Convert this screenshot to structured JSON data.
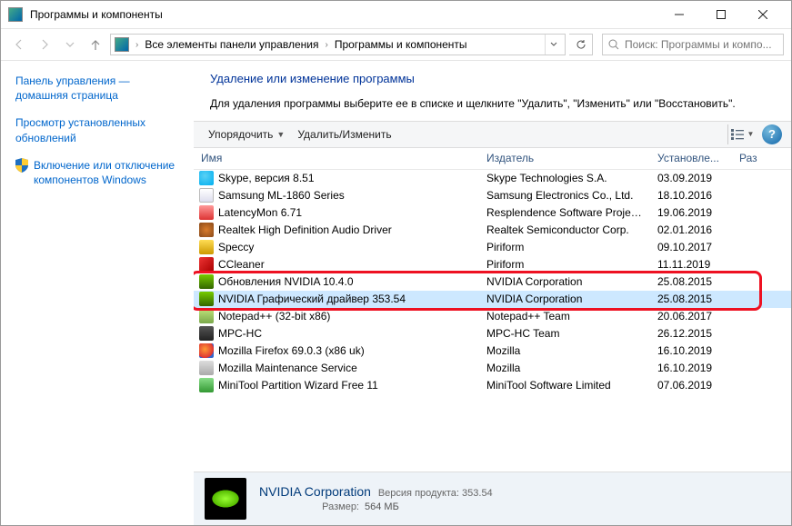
{
  "window": {
    "title": "Программы и компоненты"
  },
  "breadcrumb": {
    "item1": "Все элементы панели управления",
    "item2": "Программы и компоненты"
  },
  "search": {
    "placeholder": "Поиск: Программы и компо..."
  },
  "sidebar": {
    "items": [
      {
        "label": "Панель управления — домашняя страница"
      },
      {
        "label": "Просмотр установленных обновлений"
      },
      {
        "label": "Включение или отключение компонентов Windows"
      }
    ]
  },
  "heading": "Удаление или изменение программы",
  "subtext": "Для удаления программы выберите ее в списке и щелкните \"Удалить\", \"Изменить\" или \"Восстановить\".",
  "toolbar": {
    "organize": "Упорядочить",
    "action": "Удалить/Изменить"
  },
  "columns": {
    "name": "Имя",
    "publisher": "Издатель",
    "installed": "Установле...",
    "size": "Раз"
  },
  "programs": [
    {
      "icon": "ic-skype",
      "name": "Skype, версия 8.51",
      "publisher": "Skype Technologies S.A.",
      "date": "03.09.2019"
    },
    {
      "icon": "ic-generic",
      "name": "Samsung ML-1860 Series",
      "publisher": "Samsung Electronics Co., Ltd.",
      "date": "18.10.2016"
    },
    {
      "icon": "ic-latency",
      "name": "LatencyMon 6.71",
      "publisher": "Resplendence Software Projects...",
      "date": "19.06.2019"
    },
    {
      "icon": "ic-realtek",
      "name": "Realtek High Definition Audio Driver",
      "publisher": "Realtek Semiconductor Corp.",
      "date": "02.01.2016"
    },
    {
      "icon": "ic-speccy",
      "name": "Speccy",
      "publisher": "Piriform",
      "date": "09.10.2017"
    },
    {
      "icon": "ic-ccleaner",
      "name": "CCleaner",
      "publisher": "Piriform",
      "date": "11.11.2019"
    },
    {
      "icon": "ic-nvidia",
      "name": "Обновления NVIDIA 10.4.0",
      "publisher": "NVIDIA Corporation",
      "date": "25.08.2015"
    },
    {
      "icon": "ic-nvidia",
      "name": "NVIDIA Графический драйвер 353.54",
      "publisher": "NVIDIA Corporation",
      "date": "25.08.2015",
      "selected": true
    },
    {
      "icon": "ic-npp",
      "name": "Notepad++ (32-bit x86)",
      "publisher": "Notepad++ Team",
      "date": "20.06.2017"
    },
    {
      "icon": "ic-mpc",
      "name": "MPC-HC",
      "publisher": "MPC-HC Team",
      "date": "26.12.2015"
    },
    {
      "icon": "ic-firefox",
      "name": "Mozilla Firefox 69.0.3 (x86 uk)",
      "publisher": "Mozilla",
      "date": "16.10.2019"
    },
    {
      "icon": "ic-mozmaint",
      "name": "Mozilla Maintenance Service",
      "publisher": "Mozilla",
      "date": "16.10.2019"
    },
    {
      "icon": "ic-minitool",
      "name": "MiniTool Partition Wizard Free 11",
      "publisher": "MiniTool Software Limited",
      "date": "07.06.2019"
    }
  ],
  "details": {
    "title": "NVIDIA Corporation",
    "rows": [
      {
        "k": "Версия продукта:",
        "v": "353.54"
      },
      {
        "k": "Размер:",
        "v": "564 МБ"
      }
    ]
  },
  "highlight": {
    "fromIndex": 6,
    "toIndex": 7
  }
}
